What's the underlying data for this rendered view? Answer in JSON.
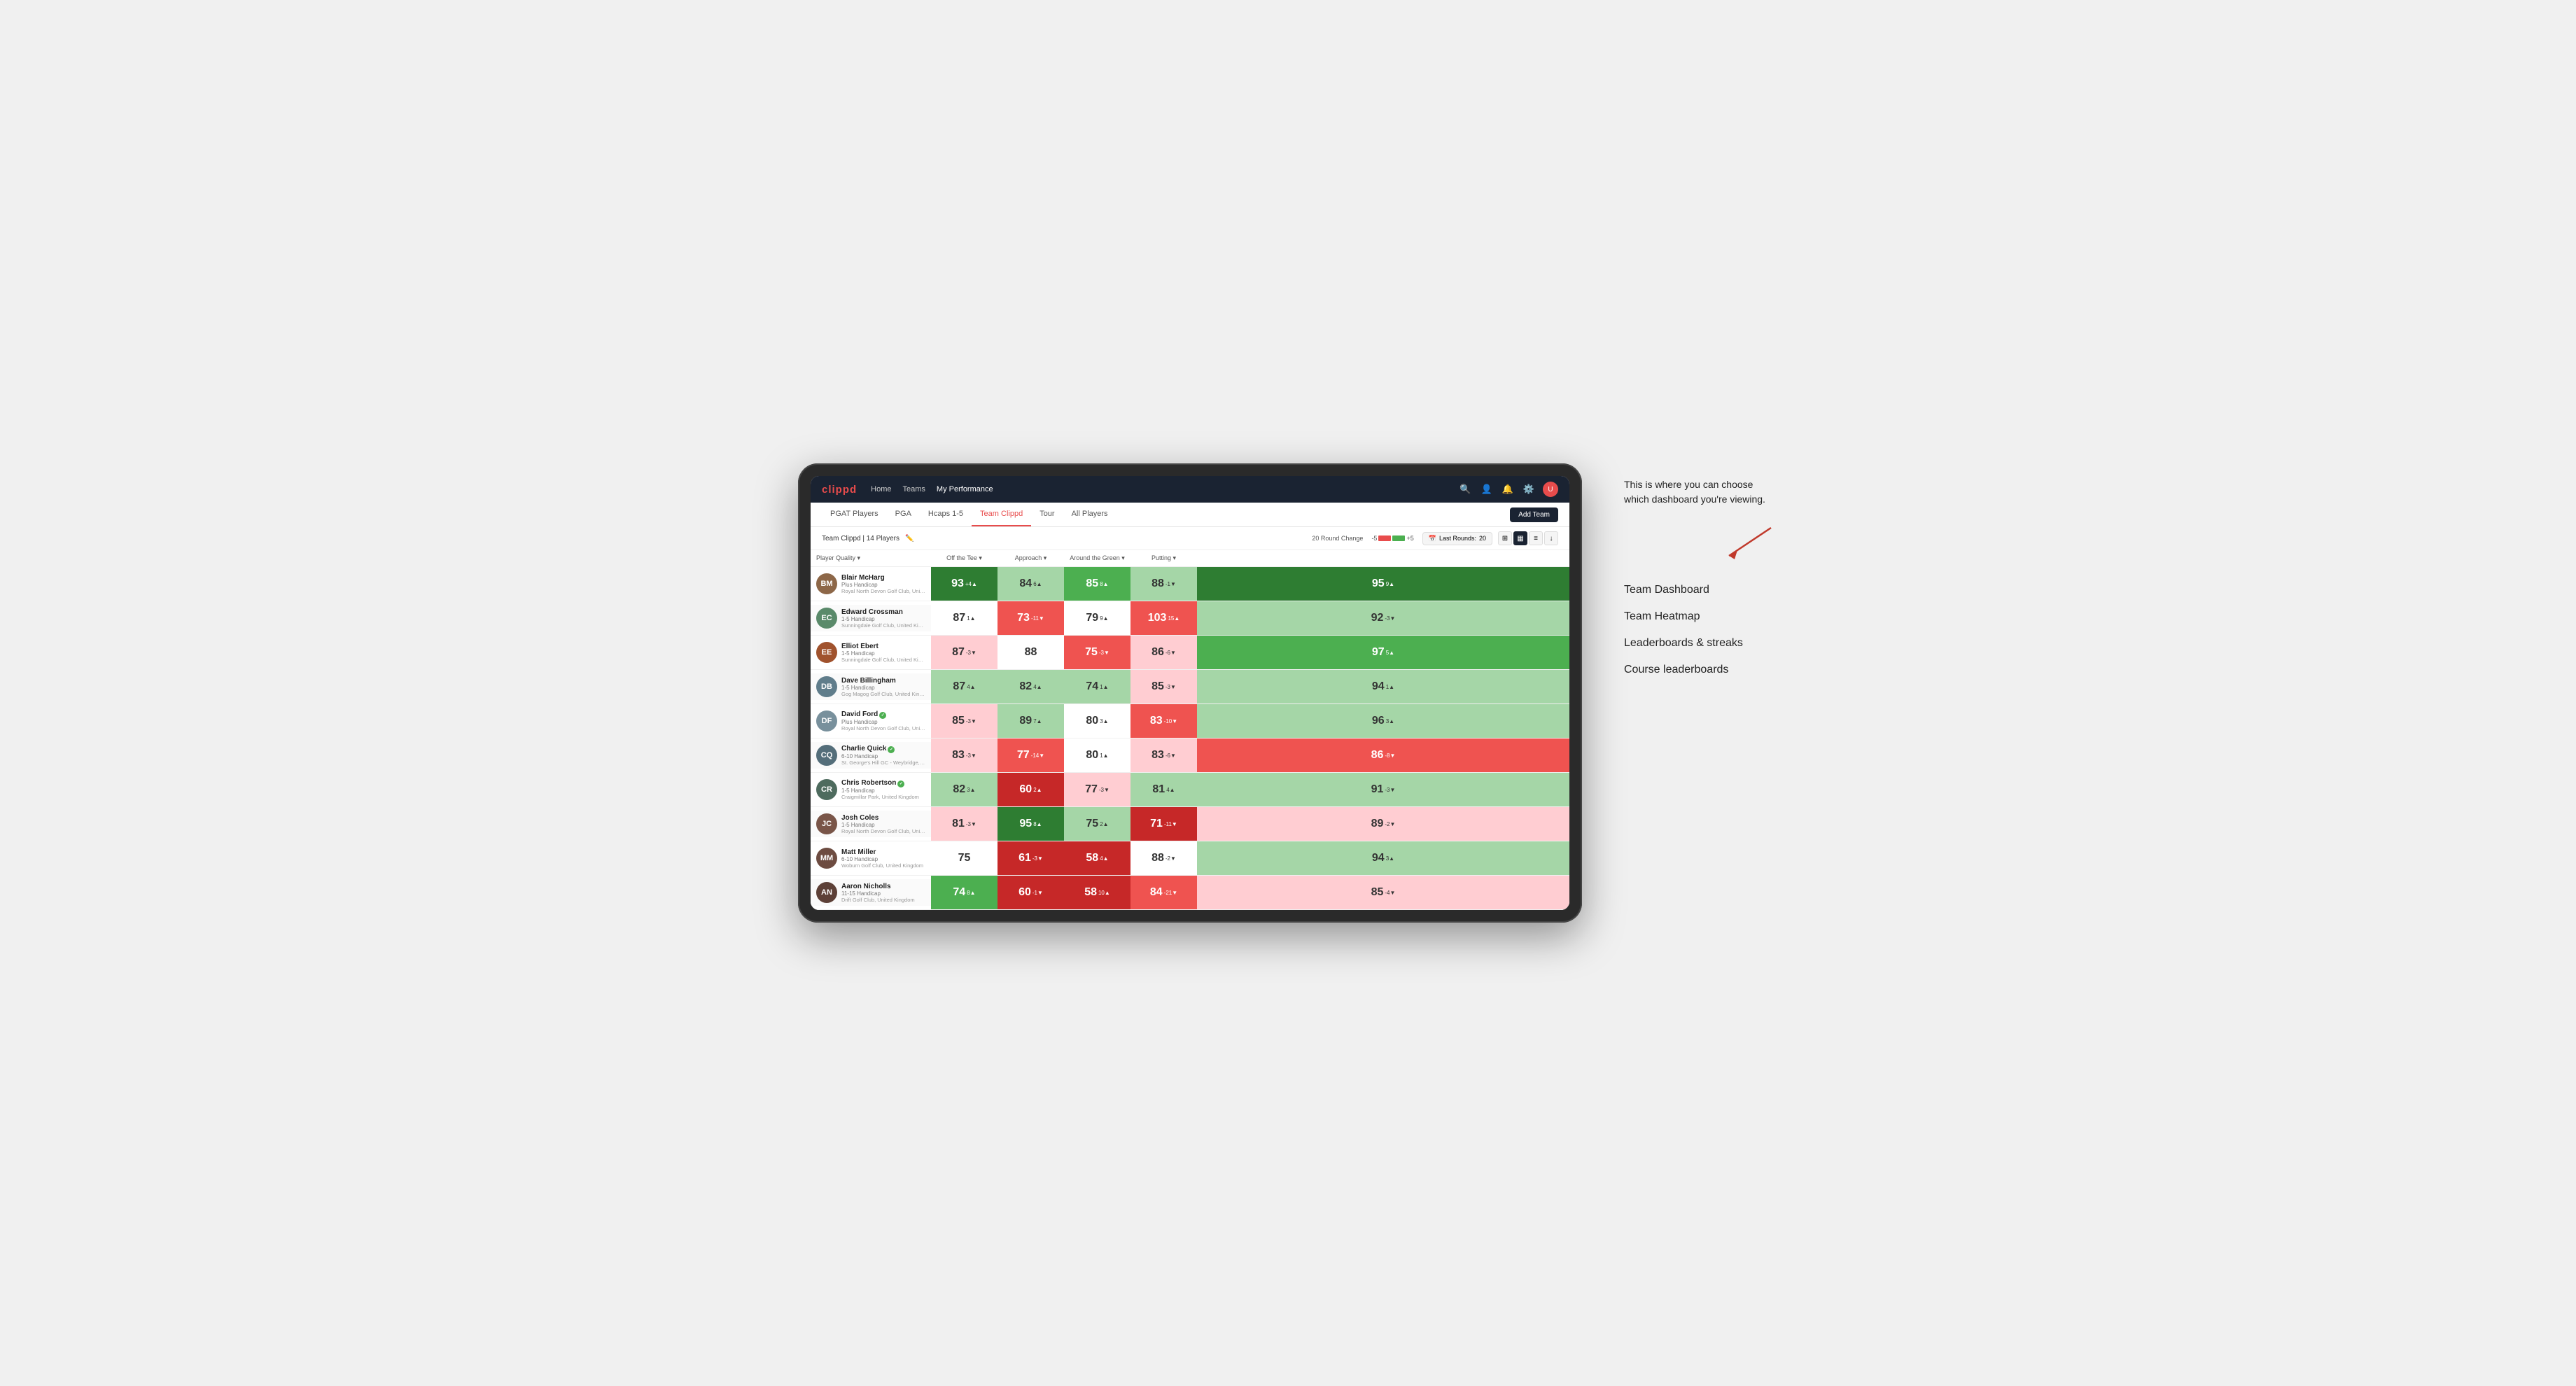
{
  "annotation": {
    "intro_text": "This is where you can choose which dashboard you're viewing.",
    "menu_options": [
      "Team Dashboard",
      "Team Heatmap",
      "Leaderboards & streaks",
      "Course leaderboards"
    ]
  },
  "nav": {
    "logo": "clippd",
    "links": [
      "Home",
      "Teams",
      "My Performance"
    ],
    "active_link": "My Performance"
  },
  "sub_nav": {
    "tabs": [
      "PGAT Players",
      "PGA",
      "Hcaps 1-5",
      "Team Clippd",
      "Tour",
      "All Players"
    ],
    "active_tab": "Team Clippd",
    "add_team_label": "Add Team"
  },
  "team_bar": {
    "team_name": "Team Clippd | 14 Players",
    "round_change_label": "20 Round Change",
    "neg_label": "-5",
    "pos_label": "+5",
    "last_rounds_label": "Last Rounds:",
    "last_rounds_value": "20"
  },
  "table": {
    "headers": {
      "player": "Player Quality ▾",
      "off_tee": "Off the Tee ▾",
      "approach": "Approach ▾",
      "around_green": "Around the Green ▾",
      "putting": "Putting ▾"
    },
    "rows": [
      {
        "name": "Blair McHarg",
        "handicap": "Plus Handicap",
        "club": "Royal North Devon Golf Club, United Kingdom",
        "initials": "BM",
        "avatar_color": "#8d6748",
        "pq": {
          "val": 93,
          "change": "+4",
          "dir": "up",
          "bg": "bg-green-strong"
        },
        "ott": {
          "val": 84,
          "change": "6",
          "dir": "up",
          "bg": "bg-green-light"
        },
        "app": {
          "val": 85,
          "change": "8",
          "dir": "up",
          "bg": "bg-green-med"
        },
        "atg": {
          "val": 88,
          "change": "-1",
          "dir": "down",
          "bg": "bg-green-light"
        },
        "put": {
          "val": 95,
          "change": "9",
          "dir": "up",
          "bg": "bg-green-strong"
        }
      },
      {
        "name": "Edward Crossman",
        "handicap": "1-5 Handicap",
        "club": "Sunningdale Golf Club, United Kingdom",
        "initials": "EC",
        "avatar_color": "#5a8a6a",
        "pq": {
          "val": 87,
          "change": "1",
          "dir": "up",
          "bg": "bg-white"
        },
        "ott": {
          "val": 73,
          "change": "-11",
          "dir": "down",
          "bg": "bg-red-med"
        },
        "app": {
          "val": 79,
          "change": "9",
          "dir": "up",
          "bg": "bg-white"
        },
        "atg": {
          "val": 103,
          "change": "15",
          "dir": "up",
          "bg": "bg-red-med"
        },
        "put": {
          "val": 92,
          "change": "-3",
          "dir": "down",
          "bg": "bg-green-light"
        }
      },
      {
        "name": "Elliot Ebert",
        "handicap": "1-5 Handicap",
        "club": "Sunningdale Golf Club, United Kingdom",
        "initials": "EE",
        "avatar_color": "#a0522d",
        "pq": {
          "val": 87,
          "change": "-3",
          "dir": "down",
          "bg": "bg-red-light"
        },
        "ott": {
          "val": 88,
          "change": "",
          "dir": "",
          "bg": "bg-white"
        },
        "app": {
          "val": 75,
          "change": "-3",
          "dir": "down",
          "bg": "bg-red-med"
        },
        "atg": {
          "val": 86,
          "change": "-6",
          "dir": "down",
          "bg": "bg-red-light"
        },
        "put": {
          "val": 97,
          "change": "5",
          "dir": "up",
          "bg": "bg-green-med"
        }
      },
      {
        "name": "Dave Billingham",
        "handicap": "1-5 Handicap",
        "club": "Gog Magog Golf Club, United Kingdom",
        "initials": "DB",
        "avatar_color": "#607d8b",
        "pq": {
          "val": 87,
          "change": "4",
          "dir": "up",
          "bg": "bg-green-light"
        },
        "ott": {
          "val": 82,
          "change": "4",
          "dir": "up",
          "bg": "bg-green-light"
        },
        "app": {
          "val": 74,
          "change": "1",
          "dir": "up",
          "bg": "bg-green-light"
        },
        "atg": {
          "val": 85,
          "change": "-3",
          "dir": "down",
          "bg": "bg-red-light"
        },
        "put": {
          "val": 94,
          "change": "1",
          "dir": "up",
          "bg": "bg-green-light"
        }
      },
      {
        "name": "David Ford",
        "handicap": "Plus Handicap",
        "club": "Royal North Devon Golf Club, United Kingdom",
        "initials": "DF",
        "avatar_color": "#78909c",
        "verified": true,
        "pq": {
          "val": 85,
          "change": "-3",
          "dir": "down",
          "bg": "bg-red-light"
        },
        "ott": {
          "val": 89,
          "change": "7",
          "dir": "up",
          "bg": "bg-green-light"
        },
        "app": {
          "val": 80,
          "change": "3",
          "dir": "up",
          "bg": "bg-white"
        },
        "atg": {
          "val": 83,
          "change": "-10",
          "dir": "down",
          "bg": "bg-red-med"
        },
        "put": {
          "val": 96,
          "change": "3",
          "dir": "up",
          "bg": "bg-green-light"
        }
      },
      {
        "name": "Charlie Quick",
        "handicap": "6-10 Handicap",
        "club": "St. George's Hill GC - Weybridge, Surrey, Uni...",
        "initials": "CQ",
        "avatar_color": "#546e7a",
        "verified": true,
        "pq": {
          "val": 83,
          "change": "-3",
          "dir": "down",
          "bg": "bg-red-light"
        },
        "ott": {
          "val": 77,
          "change": "-14",
          "dir": "down",
          "bg": "bg-red-med"
        },
        "app": {
          "val": 80,
          "change": "1",
          "dir": "up",
          "bg": "bg-white"
        },
        "atg": {
          "val": 83,
          "change": "-6",
          "dir": "down",
          "bg": "bg-red-light"
        },
        "put": {
          "val": 86,
          "change": "-8",
          "dir": "down",
          "bg": "bg-red-med"
        }
      },
      {
        "name": "Chris Robertson",
        "handicap": "1-5 Handicap",
        "club": "Craigmillar Park, United Kingdom",
        "initials": "CR",
        "avatar_color": "#4e6b5e",
        "verified": true,
        "pq": {
          "val": 82,
          "change": "3",
          "dir": "up",
          "bg": "bg-green-light"
        },
        "ott": {
          "val": 60,
          "change": "2",
          "dir": "up",
          "bg": "bg-red-strong"
        },
        "app": {
          "val": 77,
          "change": "-3",
          "dir": "down",
          "bg": "bg-red-light"
        },
        "atg": {
          "val": 81,
          "change": "4",
          "dir": "up",
          "bg": "bg-green-light"
        },
        "put": {
          "val": 91,
          "change": "-3",
          "dir": "down",
          "bg": "bg-green-light"
        }
      },
      {
        "name": "Josh Coles",
        "handicap": "1-5 Handicap",
        "club": "Royal North Devon Golf Club, United Kingdom",
        "initials": "JC",
        "avatar_color": "#795548",
        "pq": {
          "val": 81,
          "change": "-3",
          "dir": "down",
          "bg": "bg-red-light"
        },
        "ott": {
          "val": 95,
          "change": "8",
          "dir": "up",
          "bg": "bg-green-strong"
        },
        "app": {
          "val": 75,
          "change": "2",
          "dir": "up",
          "bg": "bg-green-light"
        },
        "atg": {
          "val": 71,
          "change": "-11",
          "dir": "down",
          "bg": "bg-red-strong"
        },
        "put": {
          "val": 89,
          "change": "-2",
          "dir": "down",
          "bg": "bg-red-light"
        }
      },
      {
        "name": "Matt Miller",
        "handicap": "6-10 Handicap",
        "club": "Woburn Golf Club, United Kingdom",
        "initials": "MM",
        "avatar_color": "#6d4c41",
        "pq": {
          "val": 75,
          "change": "",
          "dir": "",
          "bg": "bg-white"
        },
        "ott": {
          "val": 61,
          "change": "-3",
          "dir": "down",
          "bg": "bg-red-strong"
        },
        "app": {
          "val": 58,
          "change": "4",
          "dir": "up",
          "bg": "bg-red-strong"
        },
        "atg": {
          "val": 88,
          "change": "-2",
          "dir": "down",
          "bg": "bg-white"
        },
        "put": {
          "val": 94,
          "change": "3",
          "dir": "up",
          "bg": "bg-green-light"
        }
      },
      {
        "name": "Aaron Nicholls",
        "handicap": "11-15 Handicap",
        "club": "Drift Golf Club, United Kingdom",
        "initials": "AN",
        "avatar_color": "#5d4037",
        "pq": {
          "val": 74,
          "change": "8",
          "dir": "up",
          "bg": "bg-green-med"
        },
        "ott": {
          "val": 60,
          "change": "-1",
          "dir": "down",
          "bg": "bg-red-strong"
        },
        "app": {
          "val": 58,
          "change": "10",
          "dir": "up",
          "bg": "bg-red-strong"
        },
        "atg": {
          "val": 84,
          "change": "-21",
          "dir": "down",
          "bg": "bg-red-med"
        },
        "put": {
          "val": 85,
          "change": "-4",
          "dir": "down",
          "bg": "bg-red-light"
        }
      }
    ]
  }
}
